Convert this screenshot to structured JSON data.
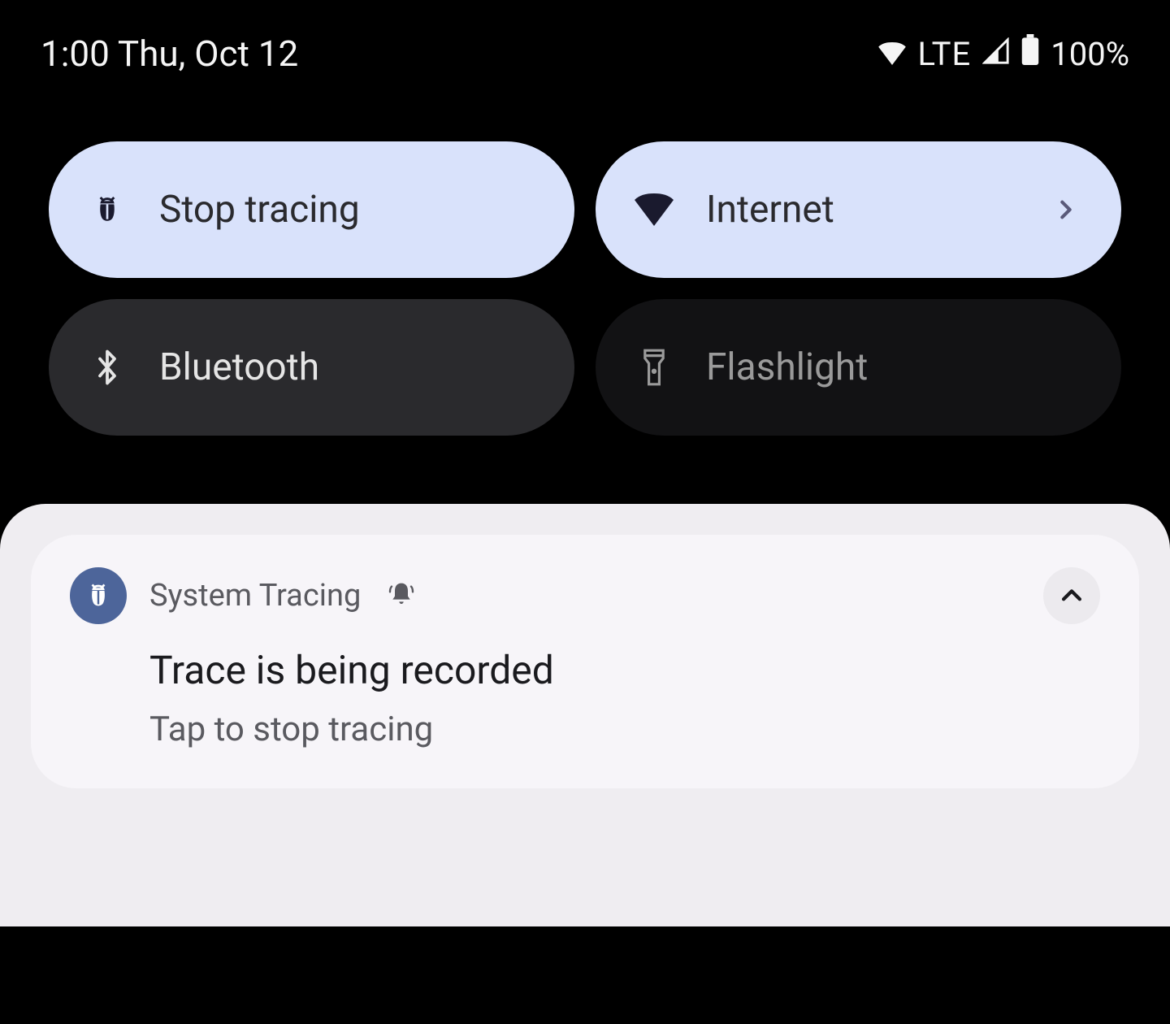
{
  "status_bar": {
    "time_date": "1:00 Thu, Oct 12",
    "network_type": "LTE",
    "battery_percent": "100%"
  },
  "tiles": {
    "stop_tracing": {
      "label": "Stop tracing"
    },
    "internet": {
      "label": "Internet"
    },
    "bluetooth": {
      "label": "Bluetooth"
    },
    "flashlight": {
      "label": "Flashlight"
    }
  },
  "notification": {
    "app_name": "System Tracing",
    "title": "Trace is being recorded",
    "subtitle": "Tap to stop tracing"
  }
}
